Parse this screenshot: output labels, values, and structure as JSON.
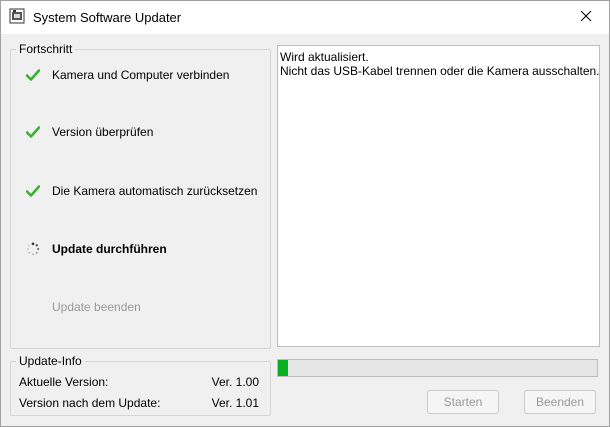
{
  "window": {
    "title": "System Software Updater"
  },
  "progress_group": {
    "legend": "Fortschritt",
    "steps": [
      {
        "label": "Kamera und Computer verbinden",
        "state": "done",
        "icon": "checkmark-icon"
      },
      {
        "label": "Version überprüfen",
        "state": "done",
        "icon": "checkmark-icon"
      },
      {
        "label": "Die Kamera automatisch zurücksetzen",
        "state": "done",
        "icon": "checkmark-icon"
      },
      {
        "label": "Update durchführen",
        "state": "active",
        "icon": "spinner-icon"
      },
      {
        "label": "Update beenden",
        "state": "pending",
        "icon": ""
      }
    ]
  },
  "log": {
    "lines": [
      "Wird aktualisiert.",
      "Nicht das USB-Kabel trennen oder die Kamera ausschalten."
    ]
  },
  "update_info": {
    "legend": "Update-Info",
    "current_label": "Aktuelle Version:",
    "current_value": "Ver. 1.00",
    "after_label": "Version nach dem Update:",
    "after_value": "Ver. 1.01"
  },
  "progress_bar": {
    "value": 0.03
  },
  "buttons": {
    "start": "Starten",
    "exit": "Beenden"
  },
  "colors": {
    "check": "#3cb034",
    "progress": "#06b025",
    "disabled_text": "#9a9a9a"
  }
}
